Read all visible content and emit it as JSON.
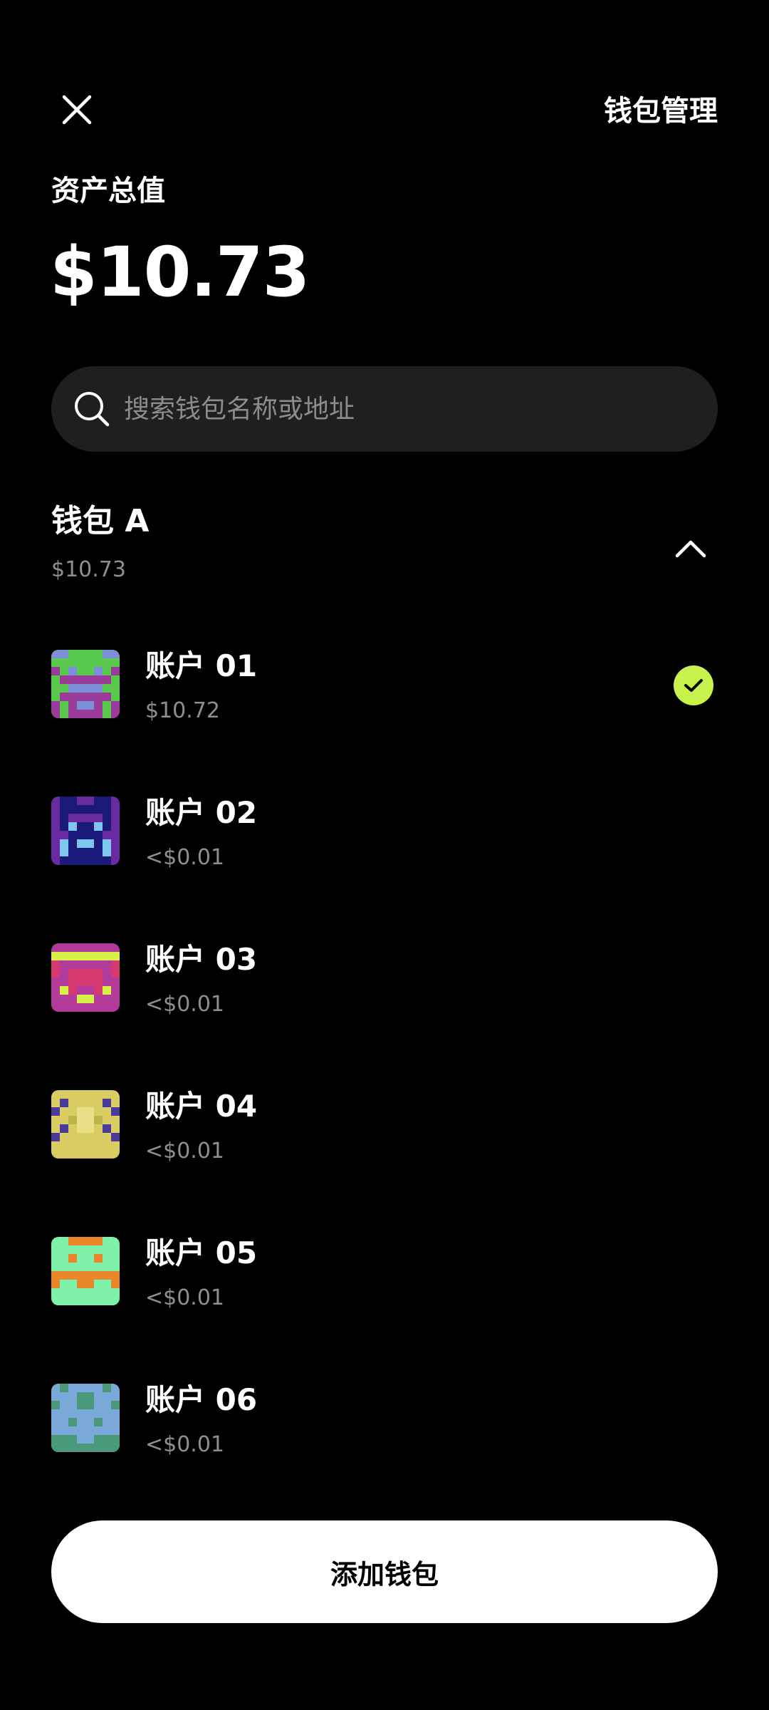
{
  "header": {
    "close_icon": "close-icon",
    "manage_label": "钱包管理"
  },
  "total": {
    "label": "资产总值",
    "value": "$10.73"
  },
  "search": {
    "placeholder": "搜索钱包名称或地址",
    "icon": "search-icon"
  },
  "wallet": {
    "name": "钱包 A",
    "value": "$10.73",
    "expanded": true
  },
  "accounts": [
    {
      "name": "账户 01",
      "balance": "$10.72",
      "selected": true
    },
    {
      "name": "账户 02",
      "balance": "<$0.01",
      "selected": false
    },
    {
      "name": "账户 03",
      "balance": "<$0.01",
      "selected": false
    },
    {
      "name": "账户 04",
      "balance": "<$0.01",
      "selected": false
    },
    {
      "name": "账户 05",
      "balance": "<$0.01",
      "selected": false
    },
    {
      "name": "账户 06",
      "balance": "<$0.01",
      "selected": false
    }
  ],
  "footer": {
    "add_label": "添加钱包"
  },
  "colors": {
    "background": "#000000",
    "accent": "#c6f24b",
    "search_bg": "#1f1f1f",
    "secondary_text": "#8f8f8f"
  }
}
